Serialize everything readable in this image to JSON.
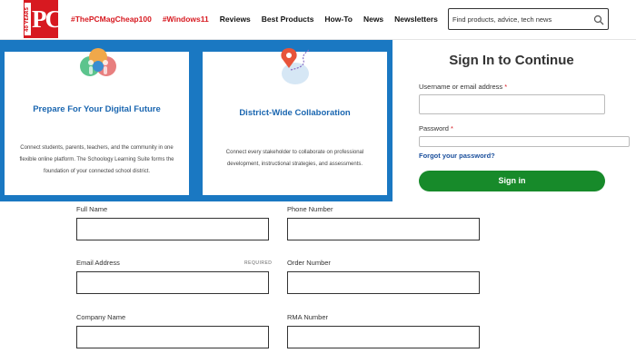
{
  "logo": {
    "letters": "PC",
    "years": "40 YEARS"
  },
  "nav": {
    "items": [
      {
        "label": "#ThePCMagCheap100",
        "hashtag": true
      },
      {
        "label": "#Windows11",
        "hashtag": true
      },
      {
        "label": "Reviews",
        "hashtag": false
      },
      {
        "label": "Best Products",
        "hashtag": false
      },
      {
        "label": "How-To",
        "hashtag": false
      },
      {
        "label": "News",
        "hashtag": false
      },
      {
        "label": "Newsletters",
        "hashtag": false
      }
    ]
  },
  "search": {
    "placeholder": "Find products, advice, tech news",
    "icon": "search-icon"
  },
  "promo": {
    "cards": [
      {
        "title": "Prepare For Your Digital Future",
        "body": "Connect students, parents, teachers, and the community in one flexible online platform. The Schoology Learning Suite forms the foundation of your connected school district.",
        "icon": "people-illustration"
      },
      {
        "title": "District-Wide Collaboration",
        "body": "Connect every stakeholder to collaborate on professional development, instructional strategies, and assessments.",
        "icon": "map-pin-illustration"
      }
    ]
  },
  "signin": {
    "title": "Sign In to Continue",
    "username_label": "Username or email address",
    "password_label": "Password",
    "required_mark": "*",
    "forgot": "Forgot your password?",
    "button": "Sign in"
  },
  "form": {
    "full_name": "Full Name",
    "phone": "Phone Number",
    "email": "Email Address",
    "required": "REQUIRED",
    "order": "Order Number",
    "company": "Company Name",
    "rma": "RMA Number"
  },
  "colors": {
    "brand_red": "#d71920",
    "promo_blue": "#1a78c2",
    "signin_green": "#178a2a",
    "link_blue": "#1a4f9c"
  }
}
